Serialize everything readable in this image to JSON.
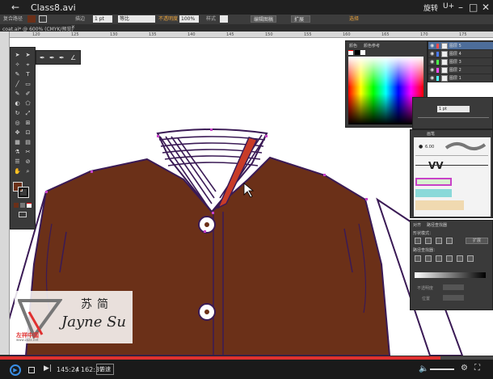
{
  "player": {
    "title": "Class8.avi",
    "menu_right": "旋转",
    "menu_right2": "U+",
    "time_current": "145:24",
    "time_separator": "/",
    "time_total": "162:37",
    "speed_button": "倍速",
    "progress": 0.893
  },
  "control_bar": {
    "object_type": "复合路径",
    "stroke_label": "描边",
    "stroke_value": "1 pt",
    "brush_label": "等比",
    "opacity_label": "不透明度",
    "opacity_value": "100%",
    "style_label": "样式",
    "btn_edit": "编辑图稿",
    "btn_extend": "扩展",
    "btn_select": "选择"
  },
  "document": {
    "tab_label": "coat.ai* @ 600% (CMYK/预览)",
    "ruler_ticks": [
      "120",
      "125",
      "130",
      "135",
      "140",
      "145",
      "150",
      "155",
      "160",
      "165",
      "170",
      "175"
    ]
  },
  "color_panel": {
    "tab_color": "颜色",
    "tab_guide": "颜色参考"
  },
  "layers_panel": {
    "layers": [
      {
        "name": "图层 5",
        "color": "#ff4a4a",
        "active": true
      },
      {
        "name": "图层 4",
        "color": "#4a7aff",
        "active": false
      },
      {
        "name": "图层 3",
        "color": "#4aff4a",
        "active": false
      },
      {
        "name": "图层 2",
        "color": "#ff4aff",
        "active": false
      },
      {
        "name": "图层 1",
        "color": "#4affff",
        "active": false
      }
    ]
  },
  "transform_panel": {
    "value": "1 pt"
  },
  "brush_panel": {
    "tab": "画笔",
    "size_value": "6.00"
  },
  "pathfinder_panel": {
    "tab_align": "对齐",
    "tab_pathfinder": "路径查找器",
    "shape_modes_label": "形状模式：",
    "expand_button": "扩展",
    "pathfinders_label": "路径查找器：",
    "opacity_label": "不透明度",
    "position_label": "位置"
  },
  "watermark": {
    "name_cn": "苏简",
    "name_en": "Jayne Su",
    "brand": "左祥中国",
    "brand_url": "www.zxzx.net"
  },
  "colors": {
    "jacket": "#6b3018",
    "collar_stripe": "#c83c28",
    "accent_red": "#e03030"
  }
}
